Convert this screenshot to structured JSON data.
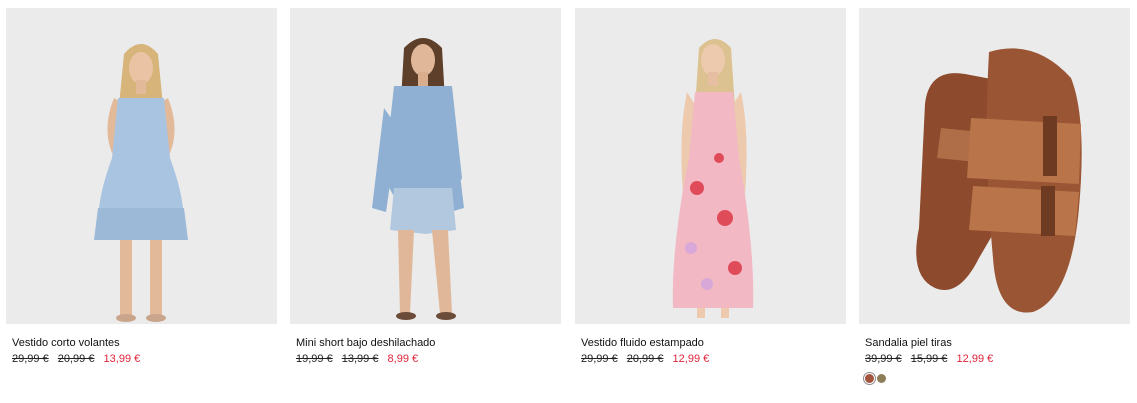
{
  "products": [
    {
      "name": "Vestido corto volantes",
      "prices": [
        "29,99 €",
        "20,99 €"
      ],
      "sale_price": "13,99 €",
      "image": "model-light-denim-dress",
      "swatches": []
    },
    {
      "name": "Mini short bajo deshilachado",
      "prices": [
        "19,99 €",
        "13,99 €"
      ],
      "sale_price": "8,99 €",
      "image": "model-denim-shirt-shorts",
      "swatches": []
    },
    {
      "name": "Vestido fluido estampado",
      "prices": [
        "29,99 €",
        "20,99 €"
      ],
      "sale_price": "12,99 €",
      "image": "model-pink-floral-dress",
      "swatches": []
    },
    {
      "name": "Sandalia piel tiras",
      "prices": [
        "39,99 €",
        "15,99 €"
      ],
      "sale_price": "12,99 €",
      "image": "brown-leather-slide-sandals",
      "swatches": [
        {
          "color": "#a4533e",
          "selected": true
        },
        {
          "color": "#8c7c58",
          "selected": false
        }
      ]
    }
  ],
  "colors": {
    "sale": "#e0243b",
    "text": "#111111",
    "photo_bg": "#ebebeb"
  }
}
